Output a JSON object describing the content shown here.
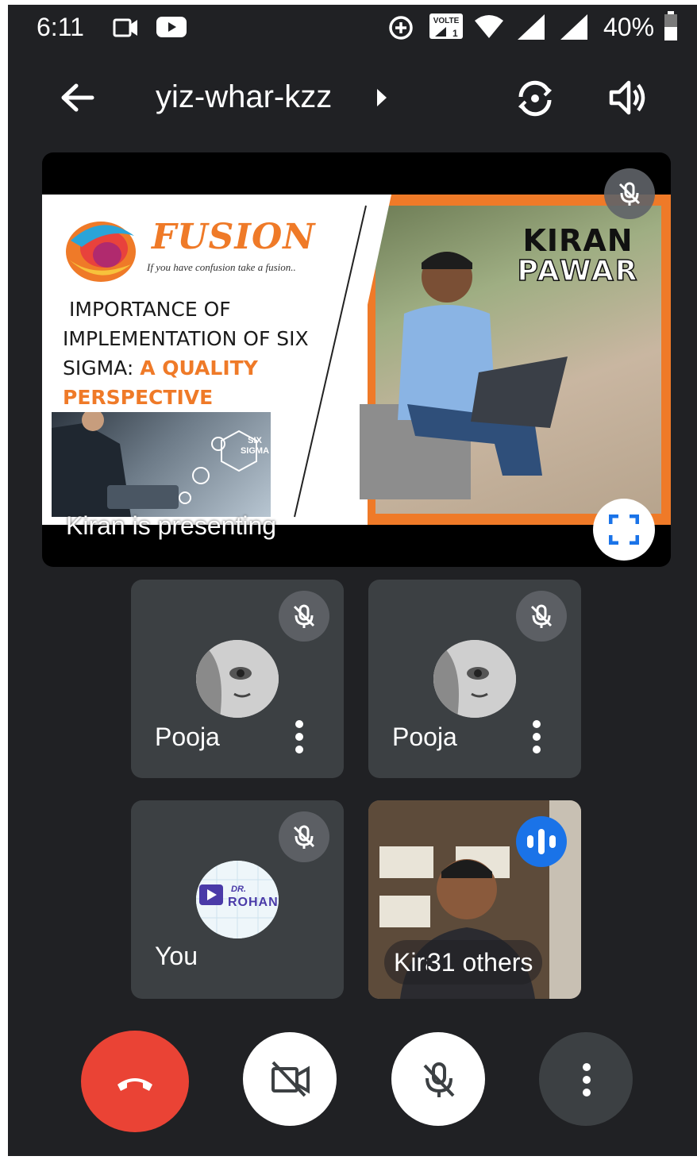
{
  "status_bar": {
    "time": "6:11",
    "network_label": "VOLTE",
    "battery": "40%"
  },
  "app_bar": {
    "meeting_code": "yiz-whar-kzz"
  },
  "presentation": {
    "slide": {
      "logo_text": "FUSION",
      "tagline": "If you have confusion take a fusion..",
      "title_line1": "IMPORTANCE OF",
      "title_line2": "IMPLEMENTATION OF SIX",
      "title_line3_prefix": "SIGMA: ",
      "title_line3_accent": "A QUALITY",
      "title_line4": "PERSPECTIVE",
      "badge_text": "SIX SIGMA",
      "presenter_first": "KIRAN",
      "presenter_last": "PAWAR"
    },
    "presenting_label": "Kiran is presenting"
  },
  "participants": [
    {
      "name": "Pooja",
      "muted": true
    },
    {
      "name": "Pooja",
      "muted": true
    },
    {
      "name": "You",
      "muted": true,
      "avatar_text_line1": "DR.",
      "avatar_text_line2": "ROHAN"
    },
    {
      "name": "Kiran",
      "others_label": "31 others",
      "speaking": true
    }
  ],
  "colors": {
    "background": "#202124",
    "tile": "#3c4043",
    "end_call": "#ea4335",
    "speaking_blue": "#1a73e8",
    "slide_orange": "#ef7a28"
  },
  "icons": {
    "back": "arrow-back-icon",
    "switch_camera": "switch-camera-icon",
    "speaker": "volume-icon",
    "mic_off": "mic-off-icon",
    "fullscreen": "fullscreen-icon",
    "more": "more-vert-icon",
    "end_call": "call-end-icon",
    "video_off": "videocam-off-icon"
  }
}
